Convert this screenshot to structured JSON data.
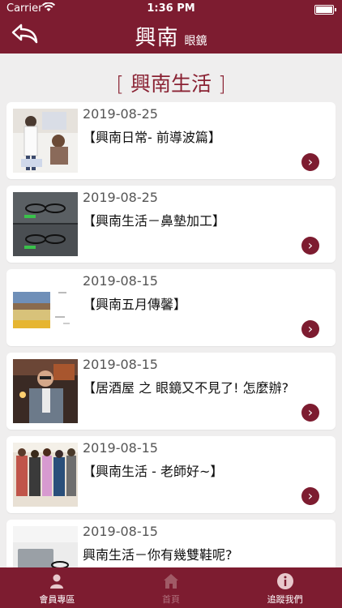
{
  "status": {
    "carrier": "Carrier",
    "time": "1:36 PM",
    "battery_level": 1.0
  },
  "header": {
    "brand": "興南",
    "brand_sub": "眼鏡",
    "back_icon": "back-arrow-icon"
  },
  "section": {
    "open": "[",
    "title": "興南生活",
    "close": "]"
  },
  "articles": [
    {
      "date": "2019-08-25",
      "title": "【興南日常- 前導波篇】"
    },
    {
      "date": "2019-08-25",
      "title": "【興南生活－鼻墊加工】"
    },
    {
      "date": "2019-08-15",
      "title": "【興南五月傳馨】"
    },
    {
      "date": "2019-08-15",
      "title": "【居酒屋 之 眼鏡又不見了! 怎麼辦?"
    },
    {
      "date": "2019-08-15",
      "title": "【興南生活 - 老師好~】"
    },
    {
      "date": "2019-08-15",
      "title": "興南生活－你有幾雙鞋呢?"
    }
  ],
  "tabs": [
    {
      "label": "會員專區",
      "icon": "person-icon"
    },
    {
      "label": "首頁",
      "icon": "home-icon"
    },
    {
      "label": "追蹤我們",
      "icon": "info-icon"
    }
  ],
  "colors": {
    "brand": "#7d1c30",
    "background": "#efeeee"
  }
}
